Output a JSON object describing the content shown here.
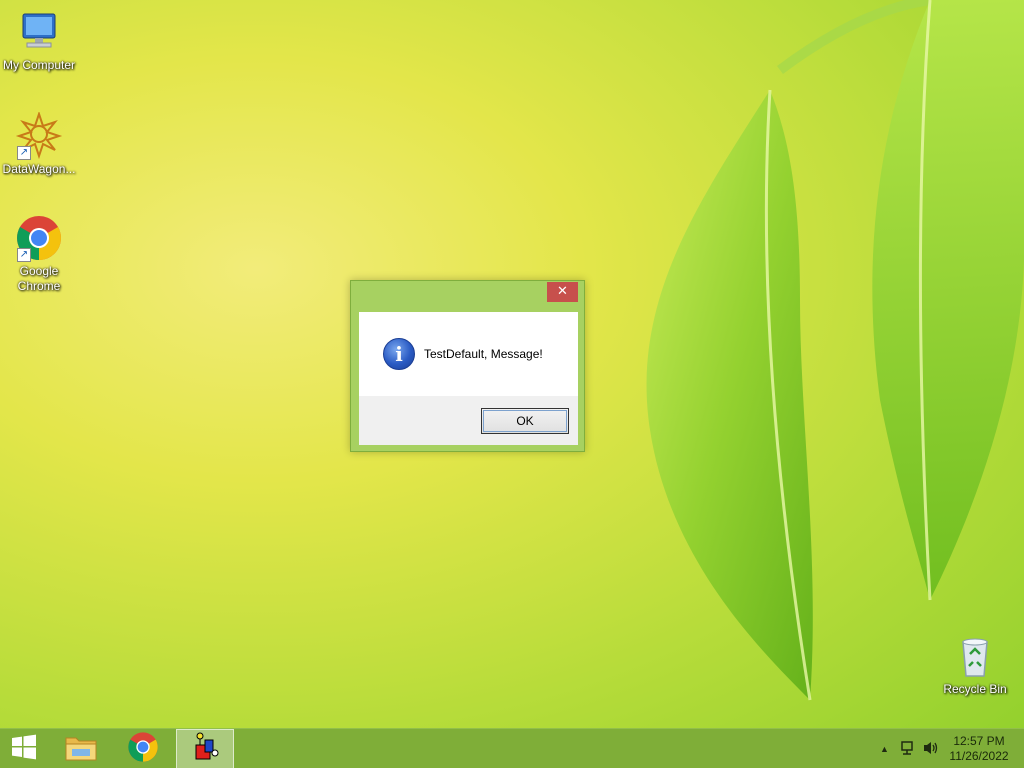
{
  "desktop": {
    "icons": [
      {
        "label": "My Computer",
        "icon": "computer-icon"
      },
      {
        "label": "DataWagon...",
        "icon": "datawagon-icon"
      },
      {
        "label": "Google Chrome",
        "icon": "chrome-icon"
      },
      {
        "label": "Recycle Bin",
        "icon": "recycle-bin-icon"
      }
    ]
  },
  "dialog": {
    "close_glyph": "✕",
    "icon": "info-icon",
    "icon_glyph": "i",
    "message": "TestDefault, Message!",
    "ok_label": "OK"
  },
  "taskbar": {
    "buttons": [
      {
        "icon": "windows-start-icon"
      },
      {
        "icon": "file-explorer-icon"
      },
      {
        "icon": "chrome-icon"
      },
      {
        "icon": "app-icon",
        "active": true
      }
    ],
    "tray": {
      "arrow_glyph": "▲",
      "network_icon": "network-icon",
      "volume_icon": "speaker-icon",
      "time": "12:57 PM",
      "date": "11/26/2022"
    }
  },
  "colors": {
    "accent": "#a7d161",
    "taskbar": "#7fae38",
    "close": "#c7504c"
  }
}
